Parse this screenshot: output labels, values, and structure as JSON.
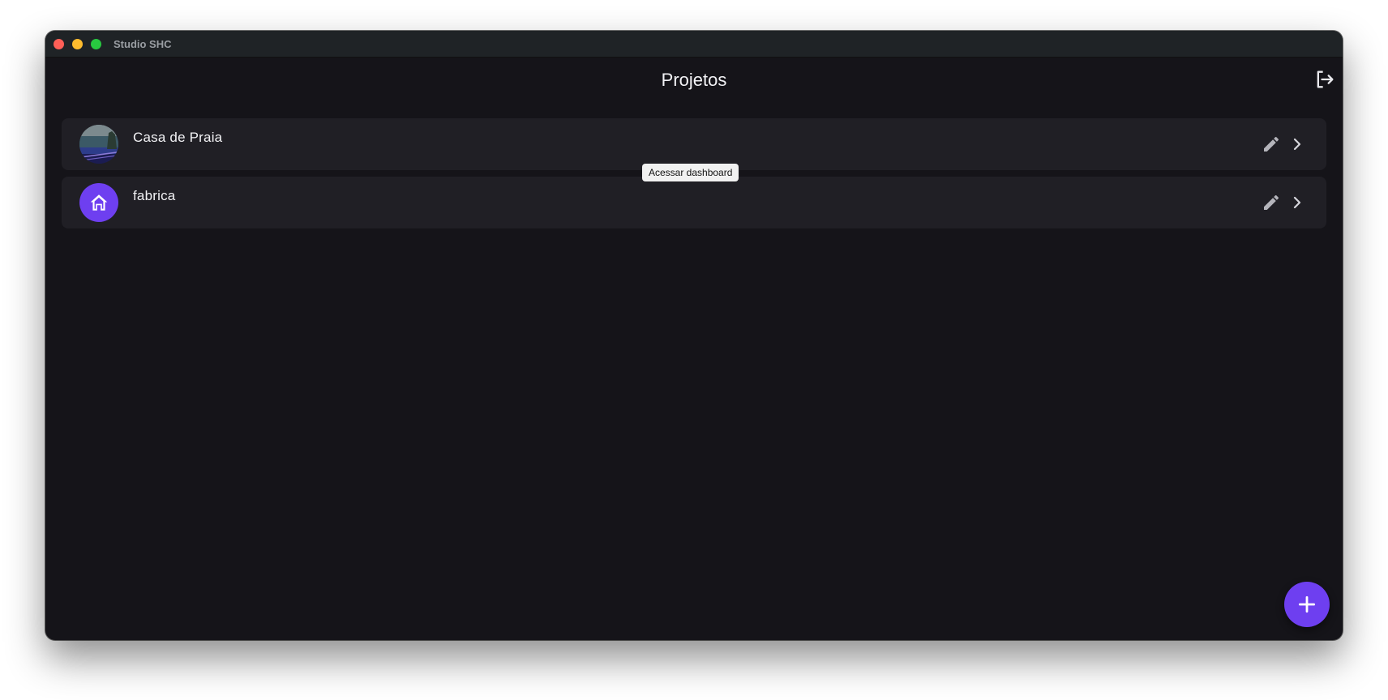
{
  "window": {
    "title": "Studio SHC"
  },
  "appbar": {
    "title": "Projetos",
    "logout_icon": "logout-icon"
  },
  "projects": [
    {
      "name": "Casa de Praia",
      "avatar_type": "photo",
      "edit_icon": "pencil-icon",
      "open_icon": "chevron-right-icon"
    },
    {
      "name": "fabrica",
      "avatar_type": "home-icon",
      "edit_icon": "pencil-icon",
      "open_icon": "chevron-right-icon"
    }
  ],
  "tooltip": {
    "text": "Acessar dashboard"
  },
  "fab": {
    "icon": "plus-icon"
  },
  "colors": {
    "background": "#151419",
    "surface": "#201f25",
    "accent": "#6e3ff0",
    "text": "#f2f2f5",
    "titlebar": "#1f2326"
  }
}
